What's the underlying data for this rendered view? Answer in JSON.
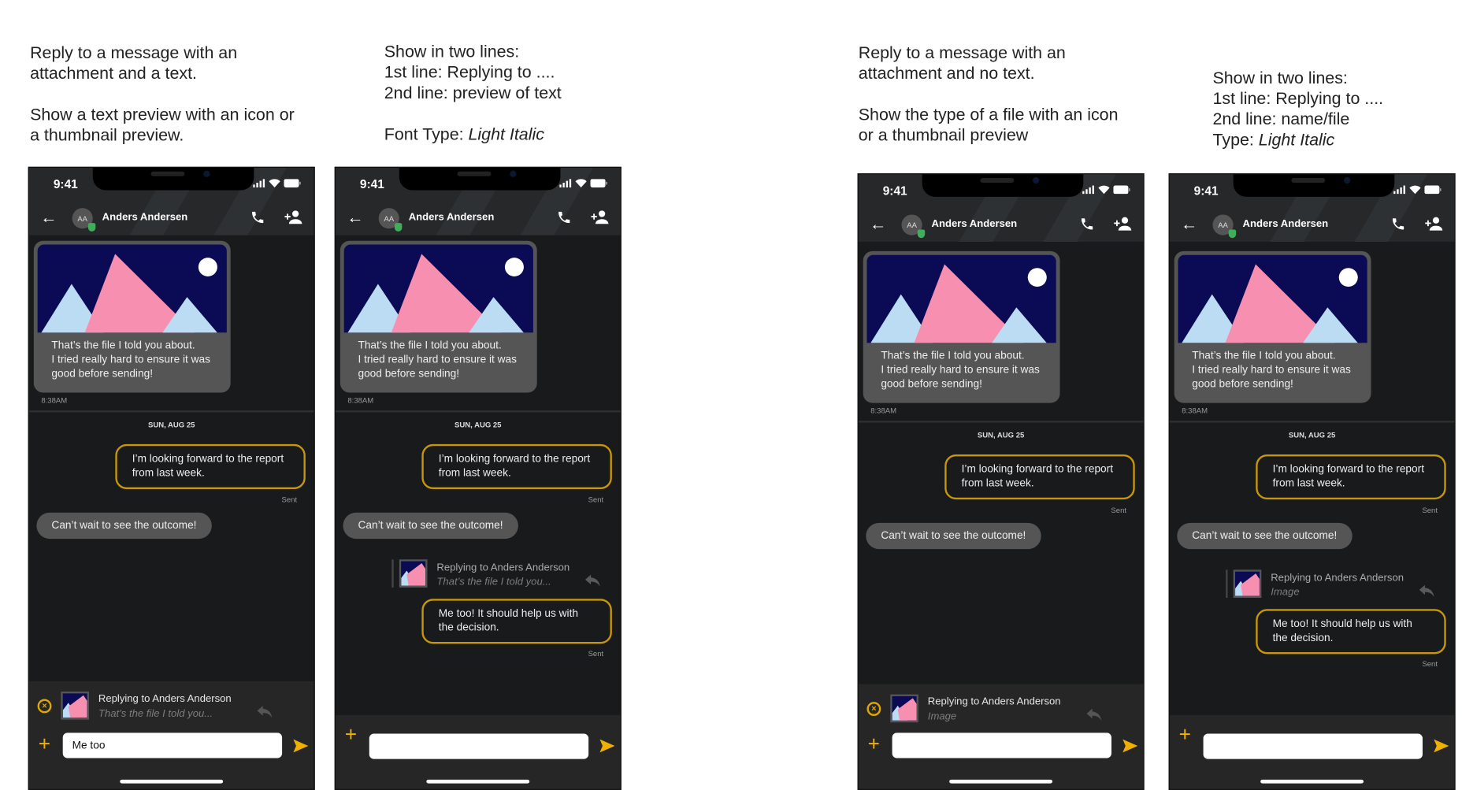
{
  "notes": [
    {
      "lines": [
        {
          "text": "Reply to a message with an"
        },
        {
          "text": "attachment and a text."
        },
        {
          "text": ""
        },
        {
          "text": "Show a text preview with an icon or"
        },
        {
          "text": "a thumbnail preview."
        }
      ]
    },
    {
      "lines": [
        {
          "text": "Show in two lines:"
        },
        {
          "text": "1st line: Replying to ...."
        },
        {
          "text": "2nd line: preview of text"
        },
        {
          "text": ""
        },
        {
          "text": "Font Type: ",
          "em": "Light Italic"
        }
      ]
    },
    {
      "lines": [
        {
          "text": "Reply to a message with an"
        },
        {
          "text": "attachment and no text."
        },
        {
          "text": ""
        },
        {
          "text": "Show the type of a file with an icon"
        },
        {
          "text": "or a thumbnail preview"
        }
      ]
    },
    {
      "lines": [
        {
          "text": "Show in two lines:"
        },
        {
          "text": "1st line: Replying to ...."
        },
        {
          "text": "2nd line: name/file"
        },
        {
          "text": "Type: ",
          "em": "Light Italic"
        }
      ]
    }
  ],
  "colors": {
    "accent": "#c8960c",
    "icon_accent": "#f0b000",
    "chat_bg": "#181a1b",
    "bubble": "#555555",
    "header": "#26282a"
  },
  "phones": [
    {
      "variant": "composer-reply",
      "time": "9:41",
      "avatar": "AA",
      "contact": "Anders Andersen",
      "image_caption": [
        "That’s the file I told you about.",
        "I tried really hard to ensure it was",
        "good before sending!"
      ],
      "timestamp": "8:38AM",
      "date": "SUN, AUG 25",
      "sent_message": [
        "I’m looking forward to the report",
        "from last week."
      ],
      "sent_status": "Sent",
      "received_message": "Can’t wait to see the outcome!",
      "reply_title": "Replying to Anders Anderson",
      "reply_preview": "That’s the file I told you...",
      "input_value": "Me too"
    },
    {
      "variant": "sent-reply",
      "time": "9:41",
      "avatar": "AA",
      "contact": "Anders Andersen",
      "image_caption": [
        "That’s the file I told you about.",
        "I tried really hard to ensure it was",
        "good before sending!"
      ],
      "timestamp": "8:38AM",
      "date": "SUN, AUG 25",
      "sent_message": [
        "I’m looking forward to the report",
        "from last week."
      ],
      "sent_status": "Sent",
      "received_message": "Can’t wait to see the outcome!",
      "reply_title": "Replying to Anders Anderson",
      "reply_preview": "That’s  the file I told you...",
      "reply_message": [
        "Me too! It should help us with",
        "the decision."
      ],
      "reply_status": "Sent",
      "input_value": ""
    },
    {
      "variant": "composer-reply",
      "time": "9:41",
      "avatar": "AA",
      "contact": "Anders Andersen",
      "image_caption": [
        "That’s the file I told you about.",
        "I tried really hard to ensure it was",
        "good before sending!"
      ],
      "timestamp": "8:38AM",
      "date": "SUN, AUG 25",
      "sent_message": [
        "I’m looking forward to the report",
        "from last week."
      ],
      "sent_status": "Sent",
      "received_message": "Can’t wait to see the outcome!",
      "reply_title": "Replying to Anders Anderson",
      "reply_preview": "Image",
      "input_value": ""
    },
    {
      "variant": "sent-reply",
      "time": "9:41",
      "avatar": "AA",
      "contact": "Anders Andersen",
      "image_caption": [
        "That’s the file I told you about.",
        "I tried really hard to ensure it was",
        "good before sending!"
      ],
      "timestamp": "8:38AM",
      "date": "SUN, AUG 25",
      "sent_message": [
        "I’m looking forward to the report",
        "from last week."
      ],
      "sent_status": "Sent",
      "received_message": "Can’t wait to see the outcome!",
      "reply_title": "Replying to Anders Anderson",
      "reply_preview": "Image",
      "reply_message": [
        "Me too! It should help us with",
        "the decision."
      ],
      "reply_status": "Sent",
      "input_value": ""
    }
  ]
}
